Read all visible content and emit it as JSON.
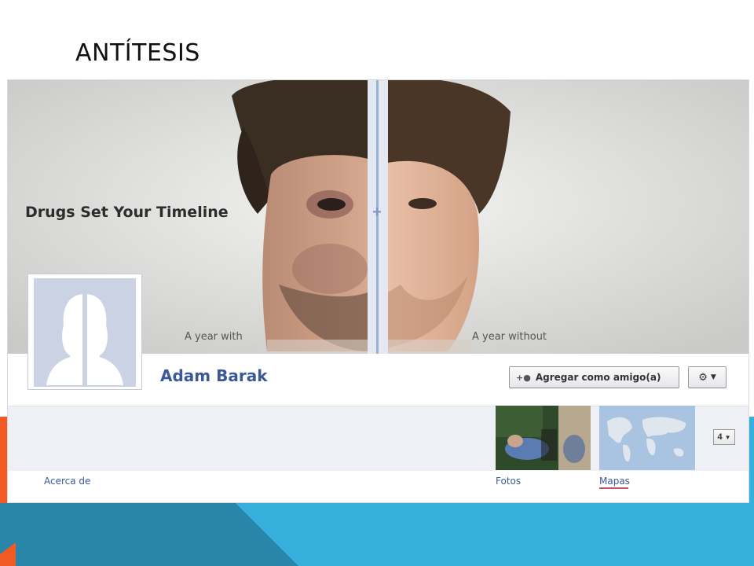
{
  "slide": {
    "title": "ANTÍTESIS",
    "colors": {
      "orange": "#f15a22",
      "cyan": "#35b0dc",
      "teal": "#2a8bb0"
    }
  },
  "profile": {
    "cover_title": "Drugs Set Your Timeline",
    "caption_left": "A year with",
    "caption_right": "A year without",
    "name": "Adam Barak",
    "add_friend_label": "Agregar como amigo(a)",
    "settings_icon": "gear-icon",
    "more_count": "4"
  },
  "tabs": {
    "about": "Acerca de",
    "photos": "Fotos",
    "maps": "Mapas"
  }
}
